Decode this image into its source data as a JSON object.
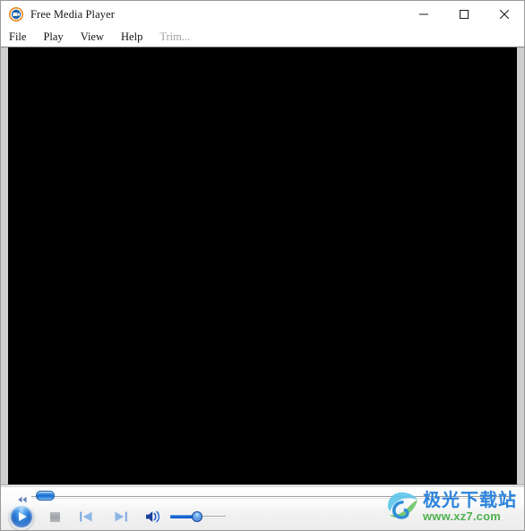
{
  "window": {
    "title": "Free Media Player",
    "app_icon": "media-player-icon",
    "border_color": "#9a9a9a",
    "titlebar_bg": "#ffffff"
  },
  "window_controls": {
    "minimize": {
      "label": "Minimize",
      "icon": "minimize-icon"
    },
    "maximize": {
      "label": "Maximize",
      "icon": "maximize-icon"
    },
    "close": {
      "label": "Close",
      "icon": "close-icon"
    }
  },
  "menubar": {
    "items": [
      {
        "label": "File",
        "disabled": false
      },
      {
        "label": "Play",
        "disabled": false
      },
      {
        "label": "View",
        "disabled": false
      },
      {
        "label": "Help",
        "disabled": false
      },
      {
        "label": "Trim...",
        "disabled": true
      }
    ]
  },
  "stage": {
    "video_background": "#000000",
    "frame_color": "#cfcfcf",
    "content": ""
  },
  "controls": {
    "seek": {
      "name": "seek-slider",
      "position_percent": 1,
      "rewind_icon": "rewind-icon"
    },
    "buttons": {
      "play": {
        "label": "Play",
        "icon": "play-icon"
      },
      "stop": {
        "label": "Stop",
        "icon": "stop-icon"
      },
      "previous": {
        "label": "Previous",
        "icon": "previous-track-icon"
      },
      "next": {
        "label": "Next",
        "icon": "next-track-icon"
      },
      "volume": {
        "label": "Volume",
        "icon": "speaker-icon"
      }
    },
    "volume": {
      "name": "volume-slider",
      "level_percent": 47
    },
    "accent_color": "#1663c8"
  },
  "watermark": {
    "brand_cn": "极光下载站",
    "url": "www.xz7.com",
    "brand_color": "#2d84dd",
    "url_color": "#4fb14f"
  }
}
